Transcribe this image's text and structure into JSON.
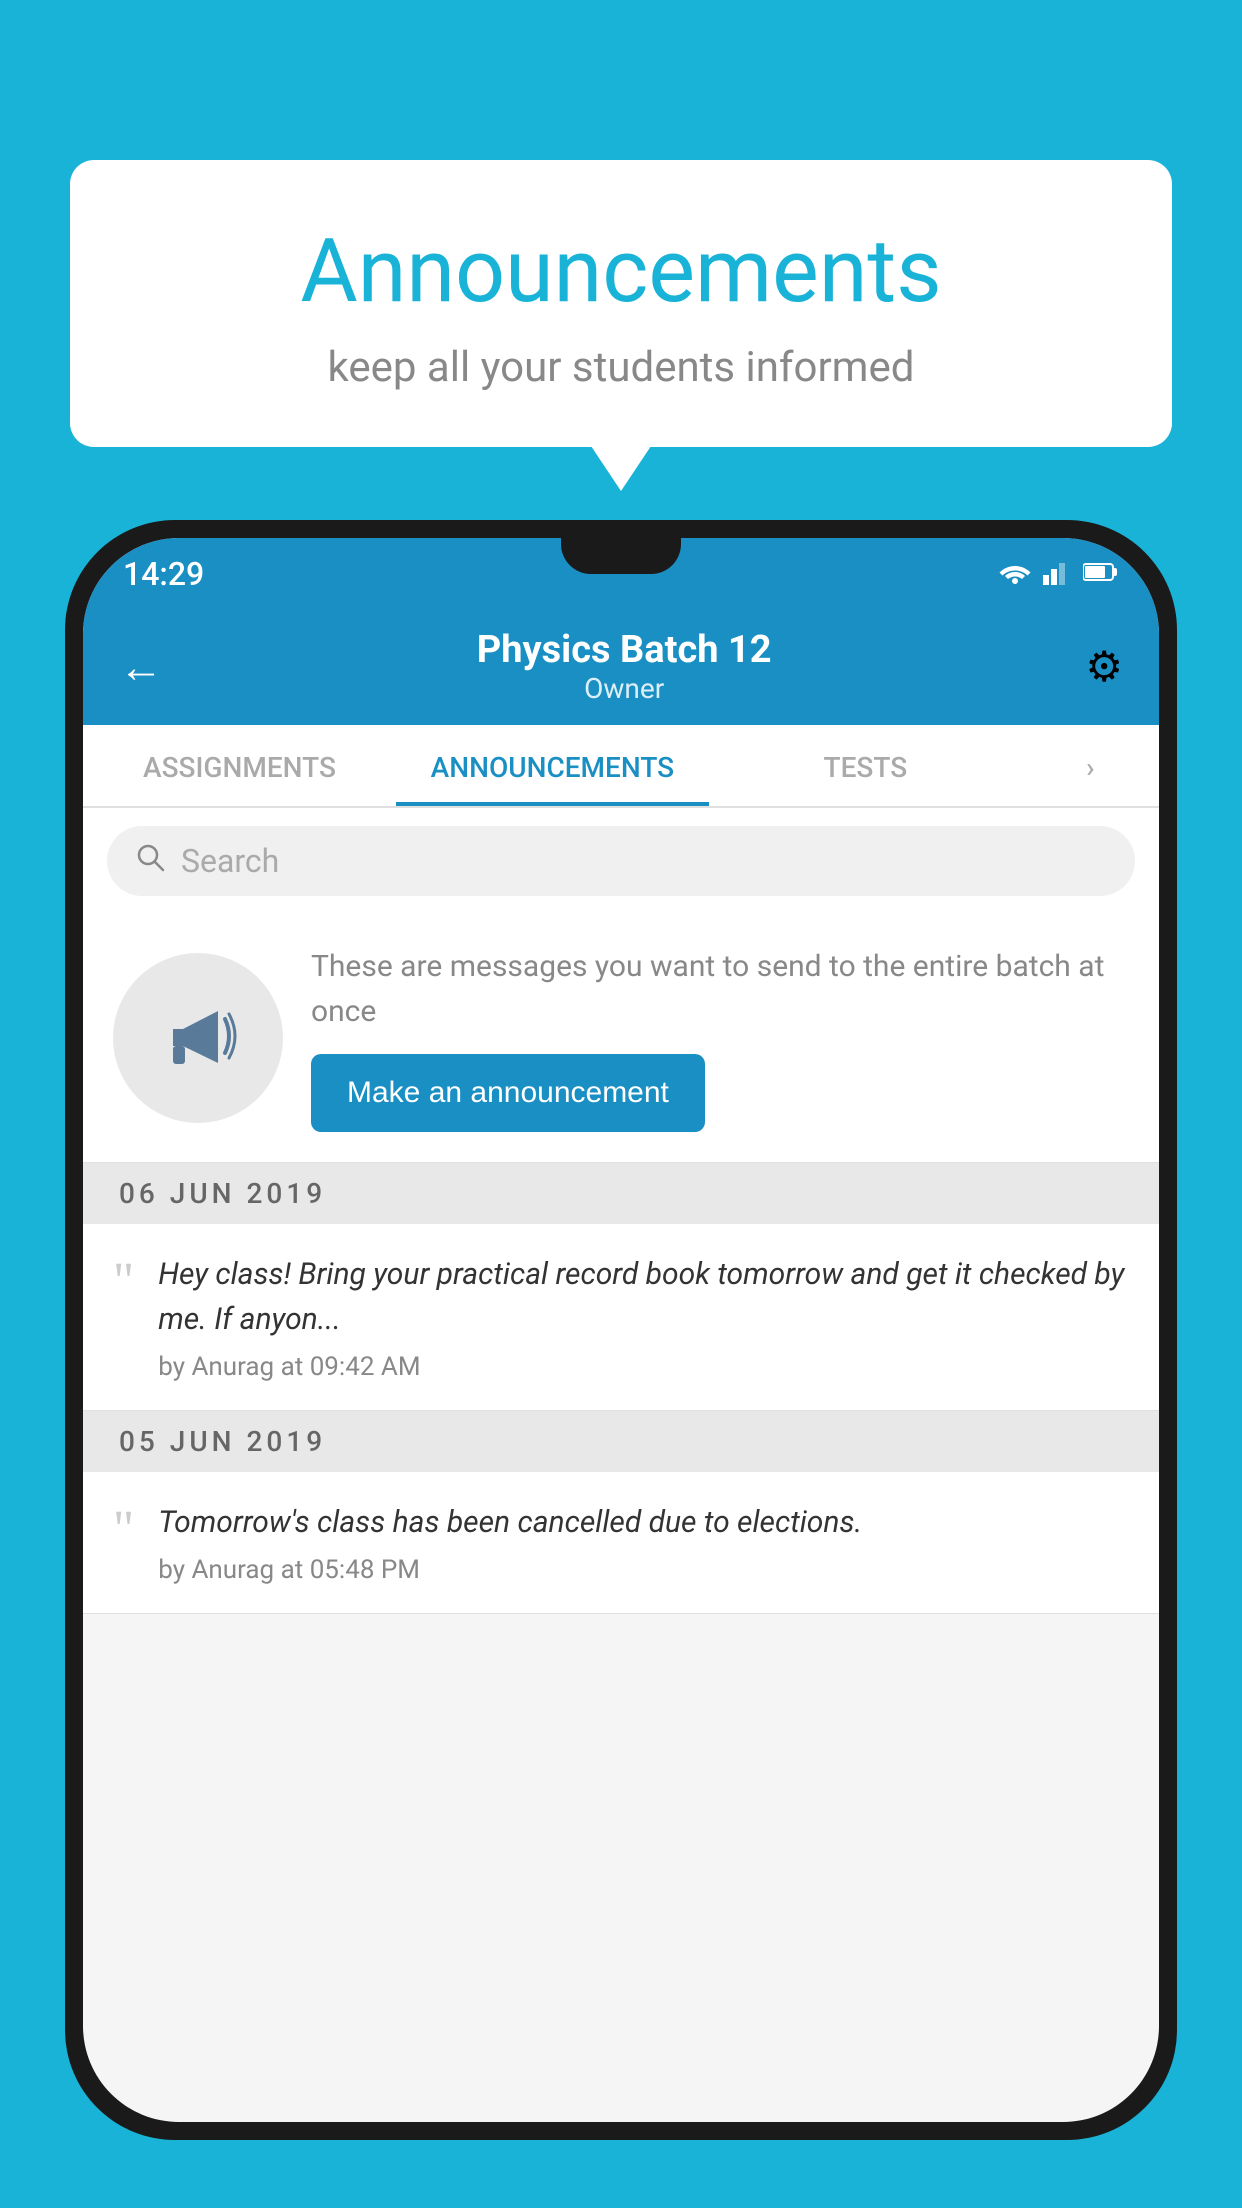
{
  "background_color": "#1ab3d8",
  "speech_bubble": {
    "title": "Announcements",
    "subtitle": "keep all your students informed"
  },
  "phone": {
    "status_bar": {
      "time": "14:29",
      "icons": [
        "wifi",
        "signal",
        "battery"
      ]
    },
    "header": {
      "title": "Physics Batch 12",
      "subtitle": "Owner",
      "back_label": "←",
      "gear_label": "⚙"
    },
    "tabs": [
      {
        "label": "ASSIGNMENTS",
        "active": false
      },
      {
        "label": "ANNOUNCEMENTS",
        "active": true
      },
      {
        "label": "TESTS",
        "active": false
      },
      {
        "label": "›",
        "active": false
      }
    ],
    "search": {
      "placeholder": "Search"
    },
    "promo": {
      "icon": "📣",
      "text": "These are messages you want to send to the entire batch at once",
      "button_label": "Make an announcement"
    },
    "announcements": [
      {
        "date": "06  JUN  2019",
        "text": "Hey class! Bring your practical record book tomorrow and get it checked by me. If anyon...",
        "meta": "by Anurag at 09:42 AM"
      },
      {
        "date": "05  JUN  2019",
        "text": "Tomorrow's class has been cancelled due to elections.",
        "meta": "by Anurag at 05:48 PM"
      }
    ]
  }
}
